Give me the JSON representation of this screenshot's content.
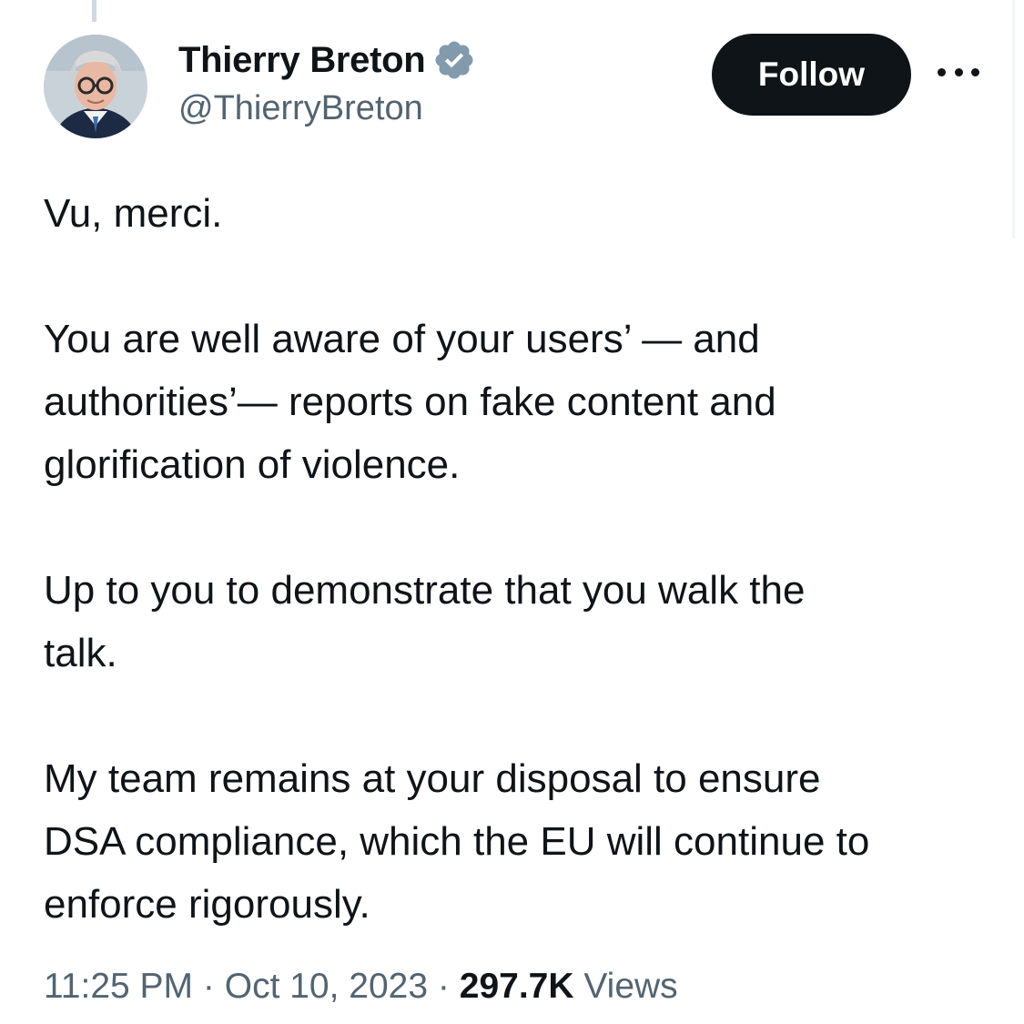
{
  "author": {
    "display_name": "Thierry Breton",
    "handle": "@ThierryBreton",
    "verified": true,
    "verified_icon": "verified-badge-icon",
    "verified_color": "#829aab"
  },
  "actions": {
    "follow_label": "Follow",
    "more_icon": "more-horizontal-icon"
  },
  "tweet": {
    "paragraphs": [
      "Vu, merci.",
      "You are well aware of your users’ — and\nauthorities’— reports on fake content and\nglorification of violence.",
      "Up to you to demonstrate that you walk the\ntalk.",
      "My team remains at your disposal to ensure\nDSA compliance, which the EU will continue to\nenforce rigorously."
    ]
  },
  "meta": {
    "time": "11:25 PM",
    "separator": "·",
    "date": "Oct 10, 2023",
    "views_count": "297.7K",
    "views_label": "Views"
  },
  "colors": {
    "text": "#0f1419",
    "secondary": "#536471",
    "button_bg": "#0f1419",
    "button_text": "#ffffff"
  }
}
